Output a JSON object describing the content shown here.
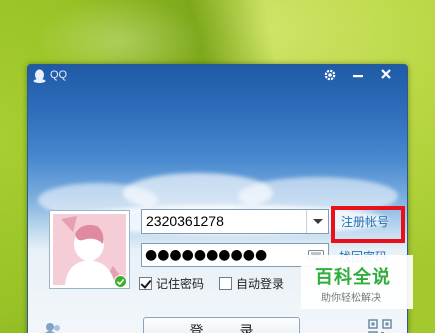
{
  "window": {
    "title": "QQ"
  },
  "login": {
    "account": "2320361278",
    "password_mask": "●●●●●●●●●●",
    "register_label": "注册帐号",
    "recover_label": "找回密码",
    "remember_label": "记住密码",
    "remember_checked": true,
    "autologin_label": "自动登录",
    "autologin_checked": false,
    "login_button_label": "登录"
  },
  "watermark": {
    "brand": "百科全说",
    "slogan": "助你轻松解决"
  },
  "colors": {
    "highlight": "#e8101a",
    "link": "#1e6fb0",
    "title_bar": "#1f5aa6"
  },
  "icons": [
    "qq-penguin-icon",
    "gear-icon",
    "minimize-icon",
    "close-icon",
    "chevron-down-icon",
    "keyboard-icon",
    "online-status-icon",
    "multi-account-icon",
    "qrcode-icon"
  ]
}
